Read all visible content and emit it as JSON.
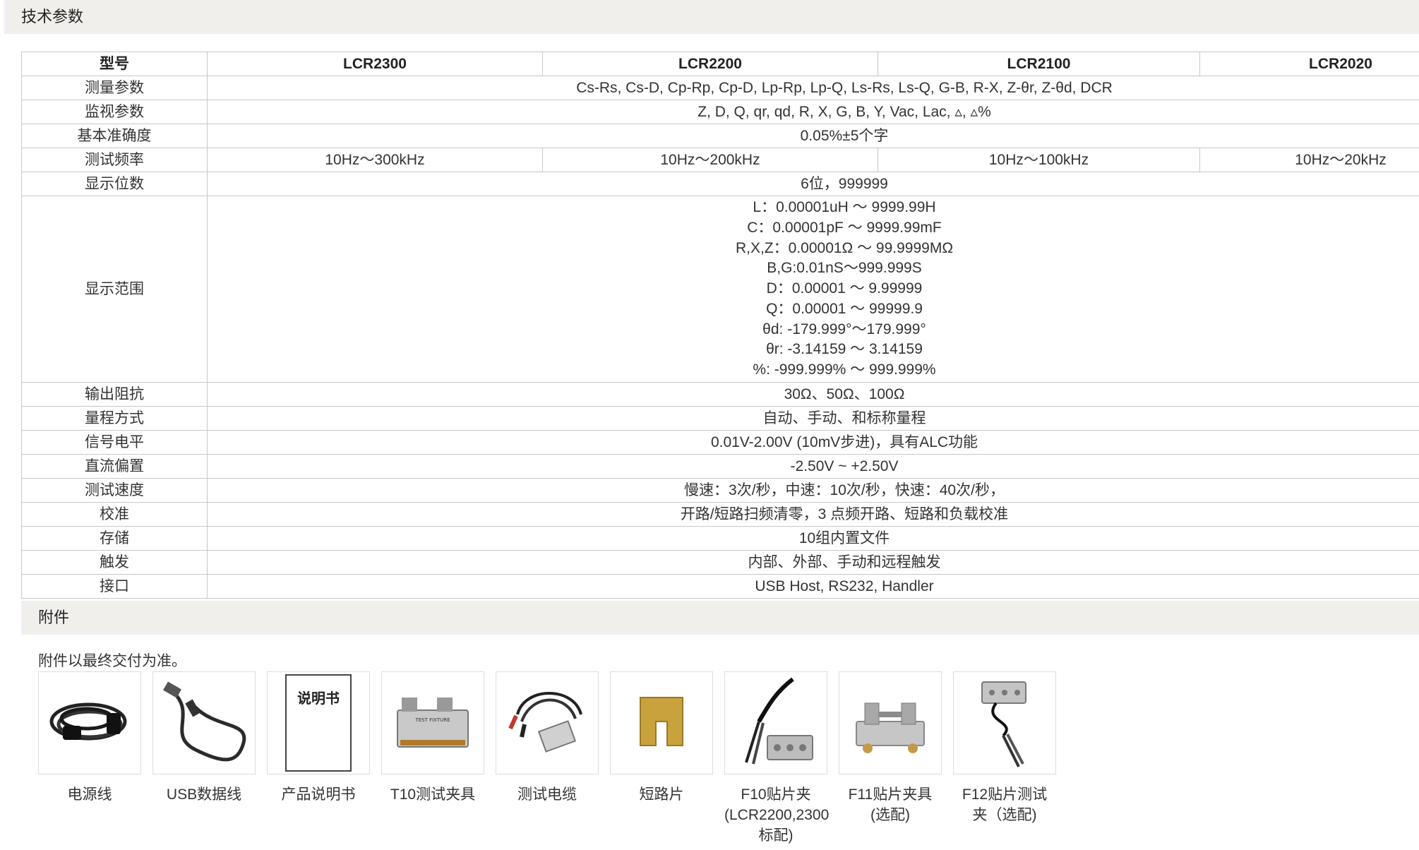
{
  "sections": {
    "spec_title": "技术参数",
    "accessories_title": "附件"
  },
  "table": {
    "header": {
      "label": "型号",
      "models": [
        "LCR2300",
        "LCR2200",
        "LCR2100",
        "LCR2020"
      ]
    },
    "rows": [
      {
        "label": "测量参数",
        "value": "Cs-Rs, Cs-D, Cp-Rp, Cp-D, Lp-Rp, Lp-Q, Ls-Rs, Ls-Q, G-B, R-X, Z-θr, Z-θd, DCR"
      },
      {
        "label": "监视参数",
        "value": "Z, D, Q, qr, qd, R, X, G, B, Y, Vac, Lac, ▵, ▵%"
      },
      {
        "label": "基本准确度",
        "value": "0.05%±5个字"
      },
      {
        "label": "测试频率",
        "values": [
          "10Hz～300kHz",
          "10Hz～200kHz",
          "10Hz～100kHz",
          "10Hz～20kHz"
        ]
      },
      {
        "label": "显示位数",
        "value": "6位，999999"
      },
      {
        "label": "显示范围",
        "lines": [
          "L：0.00001uH ～ 9999.99H",
          "C：0.00001pF ～ 9999.99mF",
          "R,X,Z：0.00001Ω ～ 99.9999MΩ",
          "B,G:0.01nS～999.999S",
          "D：0.00001 ～ 9.99999",
          "Q：0.00001 ～ 99999.9",
          "θd: -179.999°～179.999°",
          "θr: -3.14159 ～ 3.14159",
          "%: -999.999% ～ 999.999%"
        ]
      },
      {
        "label": "输出阻抗",
        "value": "30Ω、50Ω、100Ω"
      },
      {
        "label": "量程方式",
        "value": "自动、手动、和标称量程"
      },
      {
        "label": "信号电平",
        "value": "0.01V-2.00V (10mV步进)，具有ALC功能"
      },
      {
        "label": "直流偏置",
        "value": "-2.50V ~ +2.50V"
      },
      {
        "label": "测试速度",
        "value": "慢速：3次/秒，中速：10次/秒，快速：40次/秒，"
      },
      {
        "label": "校准",
        "value": "开路/短路扫频清零，3 点频开路、短路和负载校准"
      },
      {
        "label": "存储",
        "value": "10组内置文件"
      },
      {
        "label": "触发",
        "value": "内部、外部、手动和远程触发"
      },
      {
        "label": "接口",
        "value": "USB Host, RS232, Handler"
      }
    ]
  },
  "accessories": {
    "note": "附件以最终交付为准。",
    "manual_cover_text": "说明书",
    "fixture_print": "TEST FIXTURE",
    "items": [
      {
        "label": "电源线",
        "icon": "power-cord-icon"
      },
      {
        "label": "USB数据线",
        "icon": "usb-cable-icon"
      },
      {
        "label": "产品说明书",
        "icon": "manual-icon"
      },
      {
        "label": "T10测试夹具",
        "icon": "t10-fixture-icon"
      },
      {
        "label": "测试电缆",
        "icon": "test-cable-icon"
      },
      {
        "label": "短路片",
        "icon": "shorting-plate-icon"
      },
      {
        "label": "F10贴片夹\n(LCR2200,2300\n标配)",
        "icon": "f10-smd-clip-icon"
      },
      {
        "label": "F11贴片夹具\n(选配)",
        "icon": "f11-smd-fixture-icon"
      },
      {
        "label": "F12贴片测试\n夹（选配)",
        "icon": "f12-smd-test-clip-icon"
      }
    ]
  }
}
